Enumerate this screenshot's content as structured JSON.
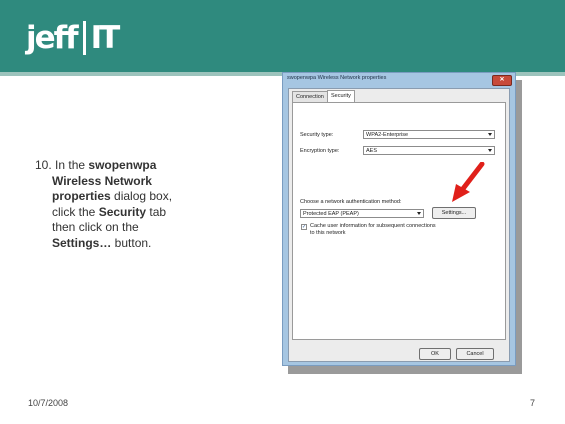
{
  "header": {
    "logo_text": "jeff",
    "logo_it": "IT",
    "colors": {
      "band": "#2f8a7e",
      "line": "#9cc3bc"
    }
  },
  "instruction": {
    "number": "10.",
    "t1": "In the ",
    "b1": "swopenwpa",
    "b2": "Wireless Network",
    "b3": "properties",
    "t2": " dialog box,",
    "t3": "click the ",
    "b4": "Security",
    "t4": " tab",
    "t5": "then click on the",
    "b5": "Settings…",
    "t6": " button."
  },
  "dialog": {
    "title": "swopenwpa Wireless Network properties",
    "tabs": [
      "Connection",
      "Security"
    ],
    "active_tab": "Security",
    "security_type_label": "Security type:",
    "security_type_value": "WPA2-Enterprise",
    "encryption_type_label": "Encryption type:",
    "encryption_type_value": "AES",
    "auth_method_label": "Choose a network authentication method:",
    "auth_method_value": "Protected EAP (PEAP)",
    "settings_button": "Settings...",
    "cache_checkbox_line1": "Cache user information for subsequent connections",
    "cache_checkbox_line2": "to this network",
    "cache_checked": true,
    "ok_button": "OK",
    "cancel_button": "Cancel",
    "close_icon": "close-icon"
  },
  "footer": {
    "date": "10/7/2008",
    "page": "7"
  },
  "annotation": {
    "arrow_color": "#e0201a",
    "icon": "red-arrow-icon"
  }
}
